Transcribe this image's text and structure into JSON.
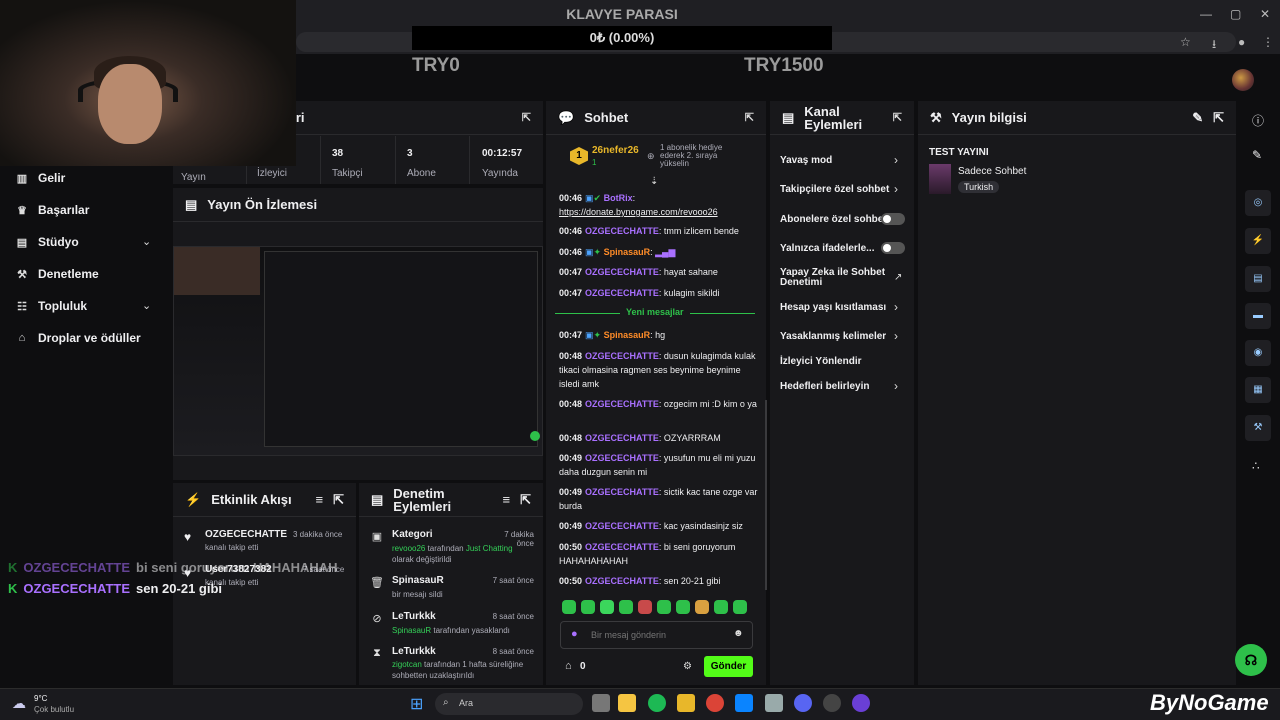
{
  "overlay": {
    "goal_title": "KLAVYE PARASI",
    "goal_progress": "0₺ (0.00%)",
    "goal_min": "TRY0",
    "goal_max": "TRY1500"
  },
  "nav": {
    "items": [
      {
        "label": "Gelir",
        "icon": "chart-icon"
      },
      {
        "label": "Başarılar",
        "icon": "trophy-icon"
      },
      {
        "label": "Stüdyo",
        "icon": "studio-icon"
      },
      {
        "label": "Denetleme",
        "icon": "wrench-icon"
      },
      {
        "label": "Topluluk",
        "icon": "people-icon"
      },
      {
        "label": "Droplar ve ödüller",
        "icon": "gift-icon"
      }
    ]
  },
  "stats": {
    "title_partial": "leri",
    "cells": [
      {
        "label": "Yayın",
        "value": ""
      },
      {
        "label": "İzleyici",
        "value": ""
      },
      {
        "label": "Takipçi",
        "value": "38"
      },
      {
        "label": "Abone",
        "value": "3"
      },
      {
        "label": "Yayında",
        "value": "00:12:57"
      }
    ]
  },
  "preview": {
    "title": "Yayın Ön İzlemesi"
  },
  "activity": {
    "title": "Etkinlik Akışı",
    "items": [
      {
        "name": "OZGECECHATTE",
        "sub": "kanalı takip etti",
        "time": "3 dakika önce"
      },
      {
        "name": "User73827382",
        "sub": "kanalı takip etti",
        "time": "7 saat önce"
      }
    ]
  },
  "moderation": {
    "title": "Denetim Eylemleri",
    "items": [
      {
        "name": "Kategori",
        "time": "7 dakika önce",
        "actor": "revooo26",
        "mid": " tarafından ",
        "target": "Just Chatting",
        "rest": " olarak değiştirildi"
      },
      {
        "name": "SpinasauR",
        "time": "7 saat önce",
        "text": "bir mesajı sildi"
      },
      {
        "name": "LeTurkkk",
        "time": "8 saat önce",
        "actor": "SpinasauR",
        "rest": " tarafından yasaklandı"
      },
      {
        "name": "LeTurkkk",
        "time": "8 saat önce",
        "actor": "zigotcan",
        "rest": " tarafından 1 hafta süreliğine sohbetten uzaklaştırıldı"
      }
    ]
  },
  "chat": {
    "title": "Sohbet",
    "pinned_user": "26nefer26",
    "pinned_count": "1",
    "pinned_rank": "1",
    "gift_text": "1 abonelik hediye ederek 2. sıraya yükselin",
    "new_messages": "Yeni mesajlar",
    "input_placeholder": "Bir mesaj gönderin",
    "points": "0",
    "send_label": "Gönder",
    "messages": [
      {
        "time": "00:46",
        "user": "BotRix",
        "text": "https://donate.bynogame.com/revooo26",
        "color": "#a970ff"
      },
      {
        "time": "00:46",
        "user": "OZGECECHATTE",
        "text": "tmm izlicem bende",
        "color": "#a970ff"
      },
      {
        "time": "00:46",
        "user": "SpinasauR",
        "text": "",
        "color": "#ff8c28"
      },
      {
        "time": "00:47",
        "user": "OZGECECHATTE",
        "text": "hayat sahane",
        "color": "#a970ff"
      },
      {
        "time": "00:47",
        "user": "OZGECECHATTE",
        "text": "kulagim sikildi",
        "color": "#a970ff"
      },
      {
        "time": "00:47",
        "user": "SpinasauR",
        "text": "hg",
        "color": "#ff8c28"
      },
      {
        "time": "00:48",
        "user": "OZGECECHATTE",
        "text": "dusun kulagimda kulak tikaci olmasina ragmen ses beynime beynime isledi amk",
        "color": "#a970ff"
      },
      {
        "time": "00:48",
        "user": "OZGECECHATTE",
        "text": "ozgecim mi :D kim o ya",
        "color": "#a970ff"
      },
      {
        "time": "00:48",
        "user": "OZGECECHATTE",
        "text": "OZYARRRAM",
        "color": "#a970ff"
      },
      {
        "time": "00:49",
        "user": "OZGECECHATTE",
        "text": "yusufun mu eli mi yuzu daha duzgun senin mi",
        "color": "#a970ff"
      },
      {
        "time": "00:49",
        "user": "OZGECECHATTE",
        "text": "sictik kac tane ozge var burda",
        "color": "#a970ff"
      },
      {
        "time": "00:49",
        "user": "OZGECECHATTE",
        "text": "kac yasindasinjz siz",
        "color": "#a970ff"
      },
      {
        "time": "00:50",
        "user": "OZGECECHATTE",
        "text": "bi seni goruyorum HAHAHAHAHAH",
        "color": "#a970ff"
      },
      {
        "time": "00:50",
        "user": "OZGECECHATTE",
        "text": "sen 20-21 gibi",
        "color": "#a970ff"
      }
    ]
  },
  "channel_actions": {
    "title": "Kanal Eylemleri",
    "items": [
      {
        "label": "Yavaş mod",
        "control": "arrow"
      },
      {
        "label": "Takipçilere özel sohbet",
        "control": "arrow"
      },
      {
        "label": "Abonelere özel sohbet",
        "control": "toggle"
      },
      {
        "label": "Yalnızca ifadelerle...",
        "control": "toggle"
      },
      {
        "label": "Yapay Zeka ile Sohbet Denetimi",
        "control": "external"
      },
      {
        "label": "Hesap yaşı kısıtlaması",
        "control": "arrow"
      },
      {
        "label": "Yasaklanmış kelimeler",
        "control": "arrow"
      },
      {
        "label": "İzleyici Yönlendir",
        "control": "none"
      },
      {
        "label": "Hedefleri belirleyin",
        "control": "arrow"
      }
    ]
  },
  "stream_info": {
    "title": "Yayın bilgisi",
    "stream_title": "TEST YAYINI",
    "category": "Sadece Sohbet",
    "language": "Turkish"
  },
  "overlay_chat": [
    {
      "user": "OZGECECHATTE",
      "text": "bi seni goruyorum HAHAHAHAH"
    },
    {
      "user": "OZGECECHATTE",
      "text": "sen 20-21 gibi"
    }
  ],
  "taskbar": {
    "temp": "9°C",
    "weather": "Çok bulutlu",
    "search": "Ara",
    "brand": "ByNoGame"
  }
}
